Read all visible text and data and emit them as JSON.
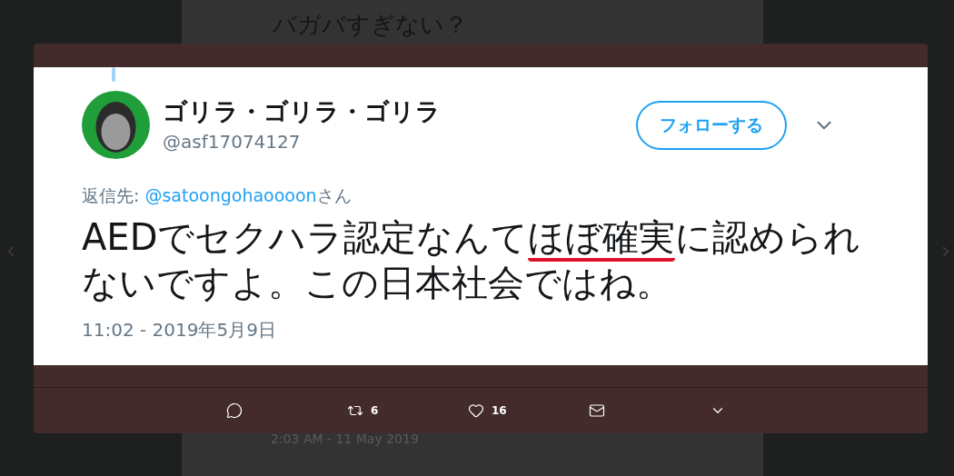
{
  "background_tweet": {
    "text_line": "バガバすぎない？",
    "timestamp": "2:03 AM - 11 May 2019"
  },
  "tweet": {
    "display_name": "ゴリラ・ゴリラ・ゴリラ",
    "handle": "@asf17074127",
    "follow_button": "フォローする",
    "reply_prefix": "返信先: ",
    "reply_to": "@satoongohaoooon",
    "reply_suffix": "さん",
    "text_parts": [
      {
        "text": "AEDでセクハラ認定なんて",
        "underlined": false
      },
      {
        "text": "ほぼ確実",
        "underlined": true
      },
      {
        "text": "に認められないですよ。この日本社会ではね。",
        "underlined": false
      }
    ],
    "timestamp": "11:02 - 2019年5月9日"
  },
  "actions": [
    {
      "kind": "reply"
    },
    {
      "kind": "retweet",
      "count": "6"
    },
    {
      "kind": "like",
      "count": "16"
    },
    {
      "kind": "message"
    },
    {
      "kind": "more"
    }
  ]
}
